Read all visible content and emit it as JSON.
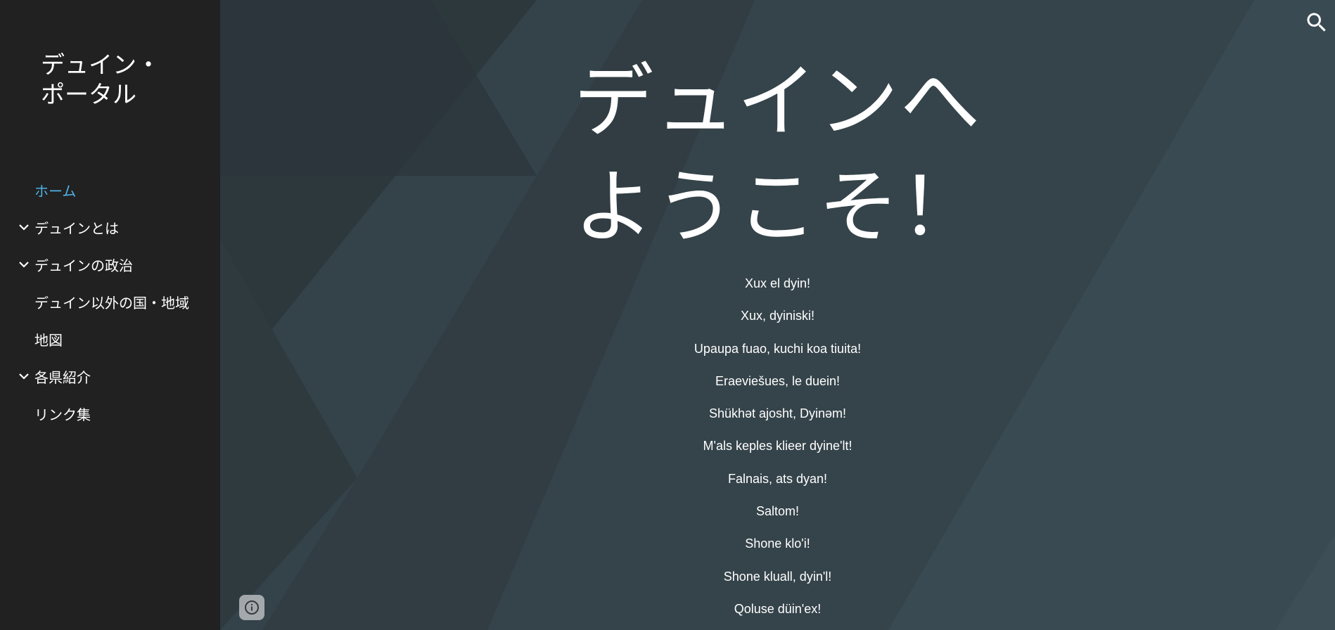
{
  "site": {
    "title": "デュイン・ポータル"
  },
  "nav": {
    "items": [
      {
        "label": "ホーム",
        "active": true,
        "expandable": false
      },
      {
        "label": "デュインとは",
        "active": false,
        "expandable": true
      },
      {
        "label": "デュインの政治",
        "active": false,
        "expandable": true
      },
      {
        "label": "デュイン以外の国・地域",
        "active": false,
        "expandable": false
      },
      {
        "label": "地図",
        "active": false,
        "expandable": false
      },
      {
        "label": "各県紹介",
        "active": false,
        "expandable": true
      },
      {
        "label": "リンク集",
        "active": false,
        "expandable": false
      }
    ]
  },
  "hero": {
    "title": "デュインへようこそ！"
  },
  "greetings": [
    "Xux el dyin!",
    "Xux, dyiniski!",
    "Upaupa fuao, kuchi koa tiuita!",
    "Eraeviešues, le duein!",
    "Shükhət ajosht, Dyinəm!",
    "M'als keples klieer dyine'lt!",
    "Falnais, ats dyan!",
    "Saltom!",
    "Shone klo'i!",
    "Shone kluall, dyin'l!",
    "Qoluse düin'ex!"
  ],
  "icons": {
    "search": "search-icon",
    "info": "info-icon",
    "chevron": "chevron-down-icon"
  },
  "colors": {
    "sidebar_bg": "#212121",
    "active_nav": "#4fb1e6",
    "main_bg": "#34424a"
  }
}
